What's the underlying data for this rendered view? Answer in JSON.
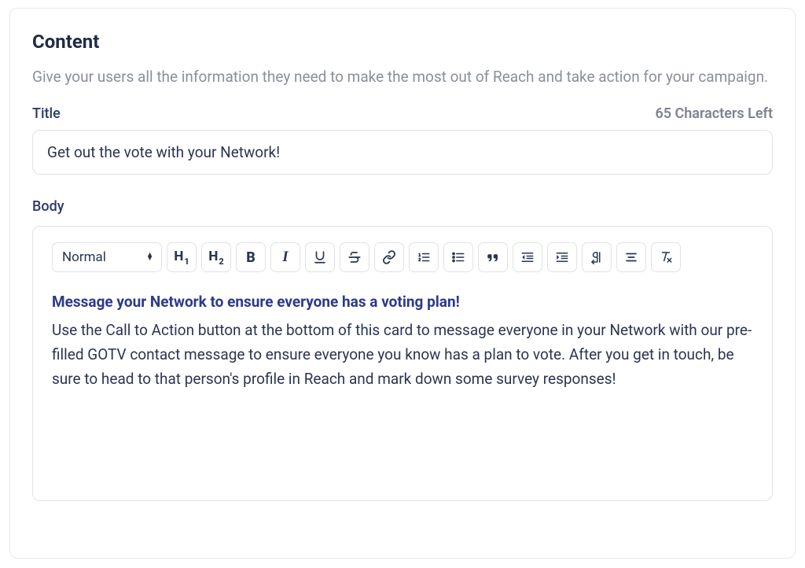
{
  "section": {
    "heading": "Content",
    "description": "Give your users all the information they need to make the most out of Reach and take action for your campaign."
  },
  "title_field": {
    "label": "Title",
    "chars_left": "65 Characters Left",
    "value": "Get out the vote with your Network!"
  },
  "body_field": {
    "label": "Body"
  },
  "toolbar": {
    "format_select": "Normal"
  },
  "body_content": {
    "headline": "Message your Network to ensure everyone has a voting plan!",
    "paragraph": "Use the Call to Action button at the bottom of this card to message everyone in your Network with our pre-filled GOTV contact message to ensure everyone you know has a plan to vote. After you get in touch, be sure to head to that person's profile in Reach and mark down some survey responses!"
  }
}
